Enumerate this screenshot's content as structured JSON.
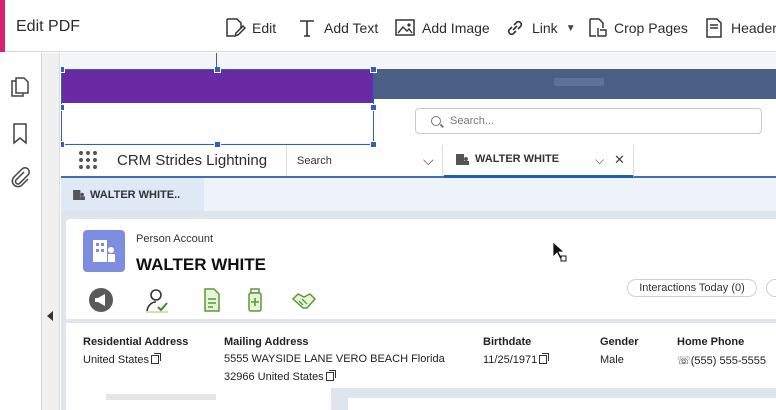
{
  "toolbar": {
    "title": "Edit PDF",
    "tools": [
      {
        "label": "Edit",
        "icon": "edit-icon"
      },
      {
        "label": "Add Text",
        "icon": "text-icon"
      },
      {
        "label": "Add Image",
        "icon": "image-icon"
      },
      {
        "label": "Link",
        "icon": "link-icon"
      },
      {
        "label": "Crop Pages",
        "icon": "crop-icon"
      },
      {
        "label": "Header",
        "icon": "header-icon"
      }
    ],
    "accent_color": "#d6246e"
  },
  "sidebar": {
    "icons": [
      "pages-icon",
      "bookmark-icon",
      "attachment-icon"
    ]
  },
  "page": {
    "search_placeholder": "Search...",
    "app_name": "CRM Strides Lightning",
    "nav_search_label": "Search",
    "tab_label": "WALTER WHITE",
    "subtab_label": "WALTER WHITE..",
    "account": {
      "type": "Person Account",
      "name": "WALTER WHITE",
      "interactions": "Interactions Today (0)"
    },
    "fields": {
      "residential_label": "Residential Address",
      "residential_value": "United States",
      "mailing_label": "Mailing Address",
      "mailing_line1": "5555 WAYSIDE LANE VERO BEACH Florida",
      "mailing_line2": "32966 United States",
      "birthdate_label": "Birthdate",
      "birthdate_value": "11/25/1971",
      "gender_label": "Gender",
      "gender_value": "Male",
      "phone_label": "Home Phone",
      "phone_value": "(555) 555-5555"
    }
  },
  "colors": {
    "purple_bar": "#6a2aa3",
    "selection": "#2f5ec4",
    "account_icon": "#7f8de1"
  }
}
